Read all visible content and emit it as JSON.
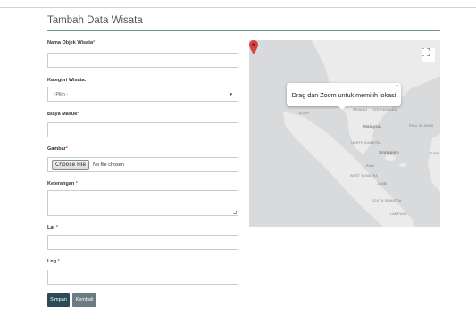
{
  "page": {
    "title": "Tambah Data Wisata"
  },
  "form": {
    "nama": {
      "label": "Nama Objek Wisata",
      "required": "*",
      "value": ""
    },
    "kategori": {
      "label": "Kategori Wisata:",
      "selected": "- Pilih -"
    },
    "biaya": {
      "label": "Biaya Masuk",
      "required": "*",
      "value": ""
    },
    "gambar": {
      "label": "Gambar",
      "required": "*",
      "button": "Choose File",
      "status": "No file chosen"
    },
    "keterangan": {
      "label": "Keterangan",
      "required": " *",
      "value": ""
    },
    "lat": {
      "label": "Lat",
      "required": " *",
      "value": ""
    },
    "lng": {
      "label": "Lng",
      "required": " *",
      "value": ""
    }
  },
  "buttons": {
    "save": "Simpan",
    "back": "Kembali"
  },
  "map": {
    "popup_text": "Drag dan Zoom untuk memilih lokasi",
    "popup_close": "×",
    "fullscreen_icon": "fullscreen-icon",
    "labels": {
      "aceh": "ACEH",
      "penang": "PENANG",
      "terengganu": "TERENGGANU",
      "malaysia": "Malaysia",
      "north_sumatra": "NORTH SUMATRA",
      "riau_islands": "RIAU ISLANDS",
      "singapore": "Singapore",
      "riau": "RIAU",
      "west_sumatra": "WEST SUMATRA",
      "jambi": "JAMBI",
      "south_sumatra": "SOUTH SUMATRA",
      "lampung": "LAMPUNG",
      "sara": "SARA"
    },
    "colors": {
      "land": "#ebebeb",
      "water": "#d8dadc",
      "marker": "#d64545"
    }
  }
}
